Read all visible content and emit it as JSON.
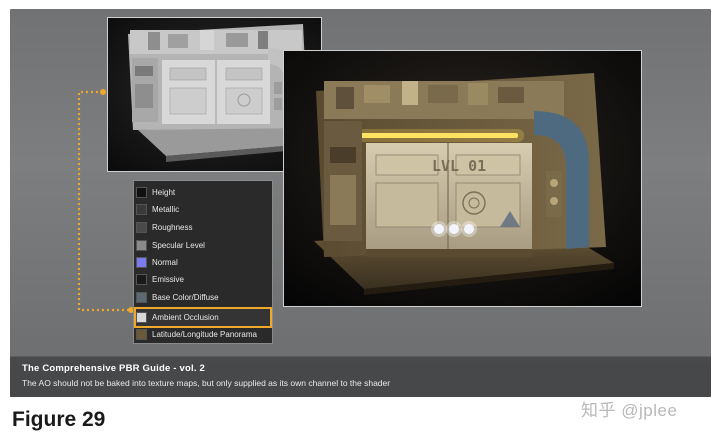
{
  "figure": {
    "caption_title": "The Comprehensive PBR Guide - vol. 2",
    "caption_text": "The AO should not be baked into texture maps, but only supplied as its own channel to the shader",
    "label": "Figure 29"
  },
  "render": {
    "door_sign": "LVL 01"
  },
  "channel_menu": {
    "items": [
      {
        "label": "Height",
        "swatch": "#111111"
      },
      {
        "label": "Metallic",
        "swatch": "#3a3a3a"
      },
      {
        "label": "Roughness",
        "swatch": "#4a4a4a"
      },
      {
        "label": "Specular Level",
        "swatch": "#8a8a8a"
      },
      {
        "label": "Normal",
        "swatch": "#7b7bf0"
      },
      {
        "label": "Emissive",
        "swatch": "#1a1a1a"
      },
      {
        "label": "Base Color/Diffuse",
        "swatch": "#5a6a70"
      },
      {
        "label": "Ambient Occlusion",
        "swatch": "#d8d8d8",
        "selected": true
      },
      {
        "label": "Latitude/Longitude Panorama",
        "swatch": "#6a5a3a"
      }
    ],
    "highlight_color": "#f0a82a"
  },
  "watermark": "知乎 @jplee"
}
